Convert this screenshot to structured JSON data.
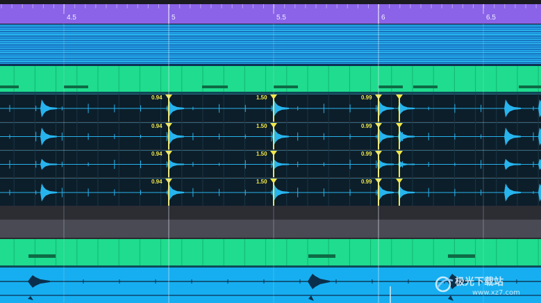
{
  "colors": {
    "ruler": "#8a63e8",
    "midi_green": "#1fdc8e",
    "audio_dark": "#0c1e2a",
    "waveform": "#27b4ee",
    "transient": "#f2e84a",
    "empty_track": "#4a4a54",
    "blue_track": "#16aef0"
  },
  "ruler": {
    "labels": [
      "4.5",
      "5",
      "5.5",
      "6",
      "6.5"
    ]
  },
  "markers": {
    "labels": [
      "0.94",
      "1.50",
      "0.99"
    ]
  },
  "watermark": {
    "text": "极光下载站",
    "url": "www.xz7.com",
    "icon": "aurora-logo-icon"
  }
}
